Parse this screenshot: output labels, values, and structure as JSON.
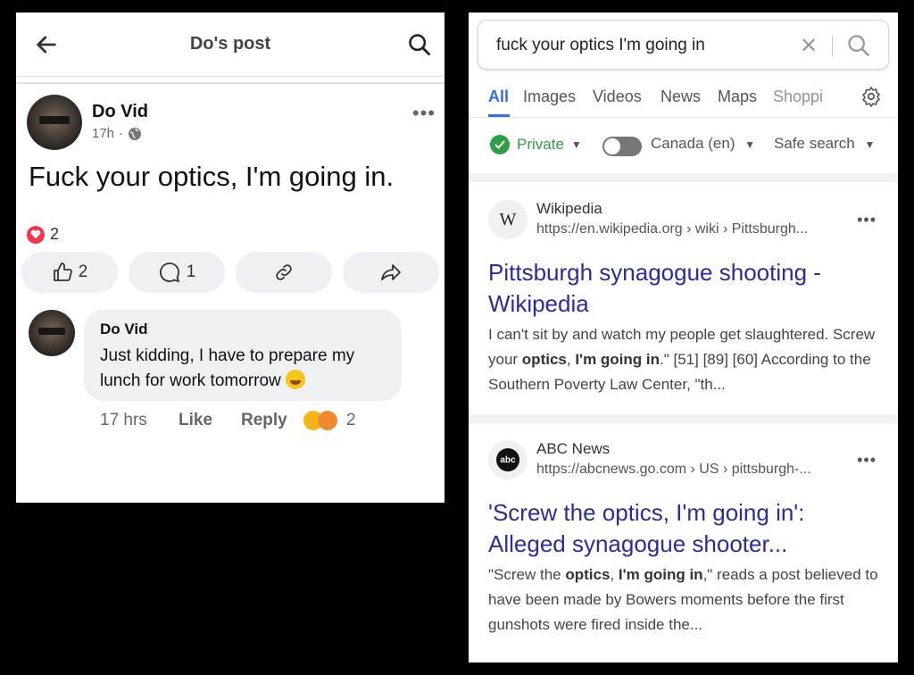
{
  "facebook": {
    "header_title": "Do's post",
    "post": {
      "author": "Do Vid",
      "time": "17h",
      "meta_sep": "·",
      "text": "Fuck your optics, I'm going in.",
      "reaction_count": "2",
      "like_count": "2",
      "comment_count": "1"
    },
    "comment": {
      "author": "Do Vid",
      "text": "Just kidding, I have to prepare my lunch for work tomorrow",
      "time": "17 hrs",
      "like_label": "Like",
      "reply_label": "Reply",
      "reaction_count": "2"
    }
  },
  "search": {
    "query": "fuck your optics I'm going in",
    "tabs": [
      "All",
      "Images",
      "Videos",
      "News",
      "Maps",
      "Shoppi"
    ],
    "filters": {
      "private": "Private",
      "region": "Canada (en)",
      "safe_search": "Safe search"
    },
    "results": [
      {
        "site": "Wikipedia",
        "icon_letter": "W",
        "url": "https://en.wikipedia.org › wiki › Pittsburgh...",
        "title": "Pittsburgh synagogue shooting - Wikipedia",
        "snippet_parts": [
          "I can't sit by and watch my people get slaughtered. Screw your ",
          "optics",
          ", ",
          "I'm going in",
          ".\" [51] [89] [60] According to the Southern Poverty Law Center, \"th..."
        ]
      },
      {
        "site": "ABC News",
        "icon_letter": "abc",
        "url": "https://abcnews.go.com › US › pittsburgh-...",
        "title": "'Screw the optics, I'm going in': Alleged synagogue shooter...",
        "snippet_parts": [
          "\"Screw the ",
          "optics",
          ", ",
          "I'm going in",
          ",\" reads a post believed to have been made by Bowers moments before the first gunshots were fired inside the..."
        ]
      }
    ]
  },
  "colors": {
    "link_blue": "#2b2b9e",
    "tab_active": "#3969ef",
    "private_green": "#2f9e44",
    "heart_red": "#f0374e"
  }
}
